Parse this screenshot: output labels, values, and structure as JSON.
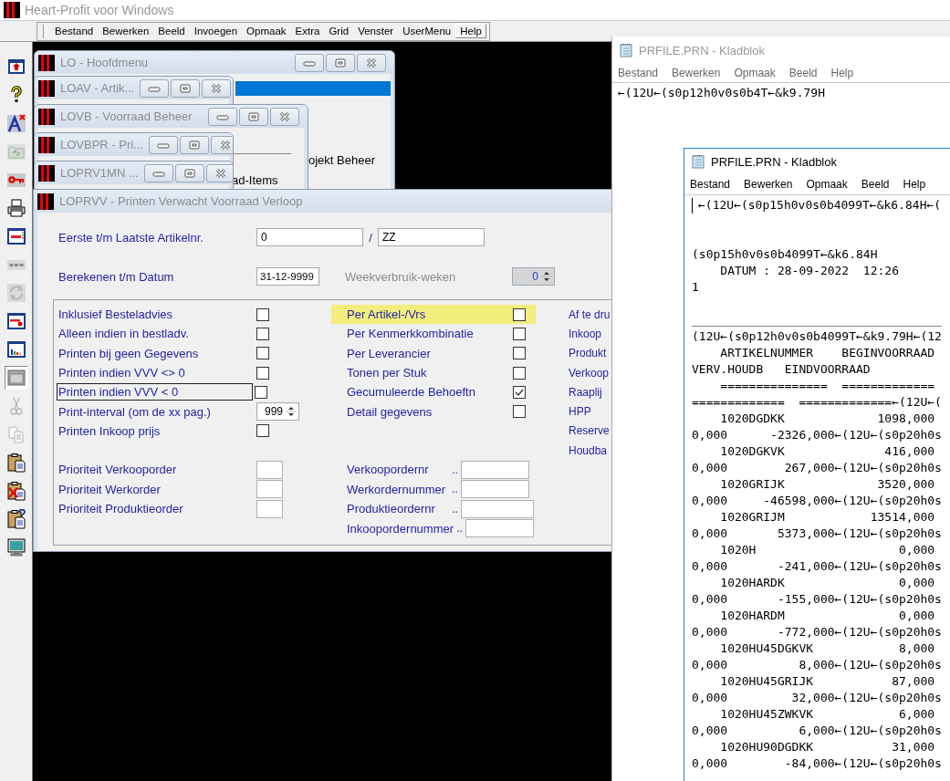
{
  "app": {
    "title": "Heart-Profit voor Windows"
  },
  "menu": [
    {
      "label": "Bestand",
      "selected": false
    },
    {
      "label": "Bewerken",
      "selected": false
    },
    {
      "label": "Beeld",
      "selected": false
    },
    {
      "label": "Invoegen",
      "selected": false
    },
    {
      "label": "Opmaak",
      "selected": false
    },
    {
      "label": "Extra",
      "selected": false
    },
    {
      "label": "Grid",
      "selected": false
    },
    {
      "label": "Venster",
      "selected": false
    },
    {
      "label": "UserMenu",
      "selected": false
    },
    {
      "label": "Help",
      "selected": true
    }
  ],
  "toolbar": [
    {
      "disabled": false,
      "selected": false
    },
    {
      "disabled": false,
      "selected": false
    },
    {
      "disabled": false,
      "selected": false
    },
    {
      "disabled": true,
      "selected": false
    },
    {
      "disabled": false,
      "selected": false
    },
    {
      "disabled": false,
      "selected": false
    },
    {
      "disabled": false,
      "selected": false
    },
    {
      "disabled": true,
      "selected": false
    },
    {
      "disabled": true,
      "selected": false
    },
    {
      "disabled": false,
      "selected": false
    },
    {
      "disabled": false,
      "selected": false
    },
    {
      "disabled": false,
      "selected": true
    },
    {
      "disabled": true,
      "selected": false
    },
    {
      "disabled": true,
      "selected": false
    },
    {
      "disabled": false,
      "selected": false
    },
    {
      "disabled": false,
      "selected": false
    },
    {
      "disabled": false,
      "selected": false
    },
    {
      "disabled": false,
      "selected": false
    }
  ],
  "windows": [
    {
      "title": "LO - Hoofdmenu",
      "text": "ojekt Beheer"
    },
    {
      "title": "LOAV - Artik..."
    },
    {
      "title": "LOVB - Voorraad Beheer",
      "text": "ad-Items"
    },
    {
      "title": "LOVBPR - Pri..."
    },
    {
      "title": "LOPRV1MN ..."
    }
  ],
  "form": {
    "title": "LOPRVV - Printen Verwacht Voorraad Verloop",
    "range": {
      "label": "Eerste t/m Laatste Artikelnr.",
      "from": "0",
      "separator": "/",
      "to": "ZZ"
    },
    "date": {
      "label": "Berekenen t/m Datum",
      "value": "31-12-9999"
    },
    "weeks": {
      "label": "Weekverbruik-weken",
      "value": "0",
      "disabled": true
    },
    "options": [
      {
        "kind": "checkbox",
        "label": "Inklusief Besteladvies",
        "checked": false,
        "focused": false
      },
      {
        "kind": "checkbox",
        "label": "Alleen indien in bestladv.",
        "checked": false,
        "focused": false
      },
      {
        "kind": "checkbox",
        "label": "Printen bij geen Gegevens",
        "checked": false,
        "focused": false
      },
      {
        "kind": "checkbox",
        "label": "Printen indien VVV <> 0",
        "checked": false,
        "focused": false
      },
      {
        "kind": "checkbox",
        "label": "Printen indien VVV < 0",
        "checked": false,
        "focused": true
      },
      {
        "kind": "spinner",
        "label": "Print-interval (om de xx pag.)",
        "value": "999",
        "focused": false
      },
      {
        "kind": "checkbox",
        "label": "Printen Inkoop prijs",
        "checked": false,
        "focused": false
      }
    ],
    "groupings": [
      {
        "label": "Per Artikel-/Vrs",
        "checked": false,
        "highlighted": true
      },
      {
        "label": "Per Kenmerkkombinatie",
        "checked": false,
        "highlighted": false
      },
      {
        "label": "Per Leverancier",
        "checked": false,
        "highlighted": false
      },
      {
        "label": "Tonen per Stuk",
        "checked": false,
        "highlighted": false
      },
      {
        "label": "Gecumuleerde Behoeftn",
        "checked": true,
        "highlighted": false
      },
      {
        "label": "Detail gegevens",
        "checked": false,
        "highlighted": false
      }
    ],
    "print_items": [
      "Af te dru",
      "Inkoop",
      "Produkt",
      "Verkoop",
      "Raaplij",
      "HPP",
      "Reserve",
      "Houdba"
    ],
    "priorities": [
      "Prioriteit Verkooporder",
      "Prioriteit Werkorder",
      "Prioriteit Produktieorder"
    ],
    "order_numbers": [
      {
        "label": "Verkoopordernr",
        "leader": ".."
      },
      {
        "label": "Werkordernummer",
        "leader": ".."
      },
      {
        "label": "Produktieordernr",
        "leader": ".."
      },
      {
        "label": "Inkoopordernummer",
        "leader": ".."
      }
    ]
  },
  "notepads": [
    {
      "title": "PRFILE.PRN - Kladblok",
      "active": false,
      "menu": [
        "Bestand",
        "Bewerken",
        "Opmaak",
        "Beeld",
        "Help"
      ],
      "text": "←(12U←(s0p12h0v0s0b4T←&k9.79H"
    },
    {
      "title": "PRFILE.PRN - Kladblok",
      "active": true,
      "menu": [
        "Bestand",
        "Bewerken",
        "Opmaak",
        "Beeld",
        "Help"
      ],
      "text": "←(12U←(s0p15h0v0s0b4099T←&k6.84H←(\n\n\n(s0p15h0v0s0b4099T←&k6.84H\n    DATUM : 28-09-2022  12:26\n1\n\n___________________________________\n(12U←(s0p12h0v0s0b4099T←&k9.79H←(12\n    ARTIKELNUMMER    BEGINVOORRAAD\nVERV.HOUDB   EINDVOORRAAD\n    ===============  =============\n=============  =============←(12U←(\n    1020DGDKK             1098,000\n0,000      -2326,000←(12U←(s0p20h0s\n    1020DGKVK              416,000\n0,000        267,000←(12U←(s0p20h0s\n    1020GRIJK             3520,000\n0,000     -46598,000←(12U←(s0p20h0s\n    1020GRIJM            13514,000\n0,000       5373,000←(12U←(s0p20h0s\n    1020H                    0,000\n0,000       -241,000←(12U←(s0p20h0s\n    1020HARDK                0,000\n0,000       -155,000←(12U←(s0p20h0s\n    1020HARDM                0,000\n0,000       -772,000←(12U←(s0p20h0s\n    1020HU45DGKVK            8,000\n0,000          8,000←(12U←(s0p20h0s\n    1020HU45GRIJK           87,000\n0,000         32,000←(12U←(s0p20h0s\n    1020HU45ZWKVK            6,000\n0,000          6,000←(12U←(s0p20h0s\n    1020HU90DGDKK           31,000\n0,000        -84,000←(12U←(s0p20h0s"
    }
  ]
}
